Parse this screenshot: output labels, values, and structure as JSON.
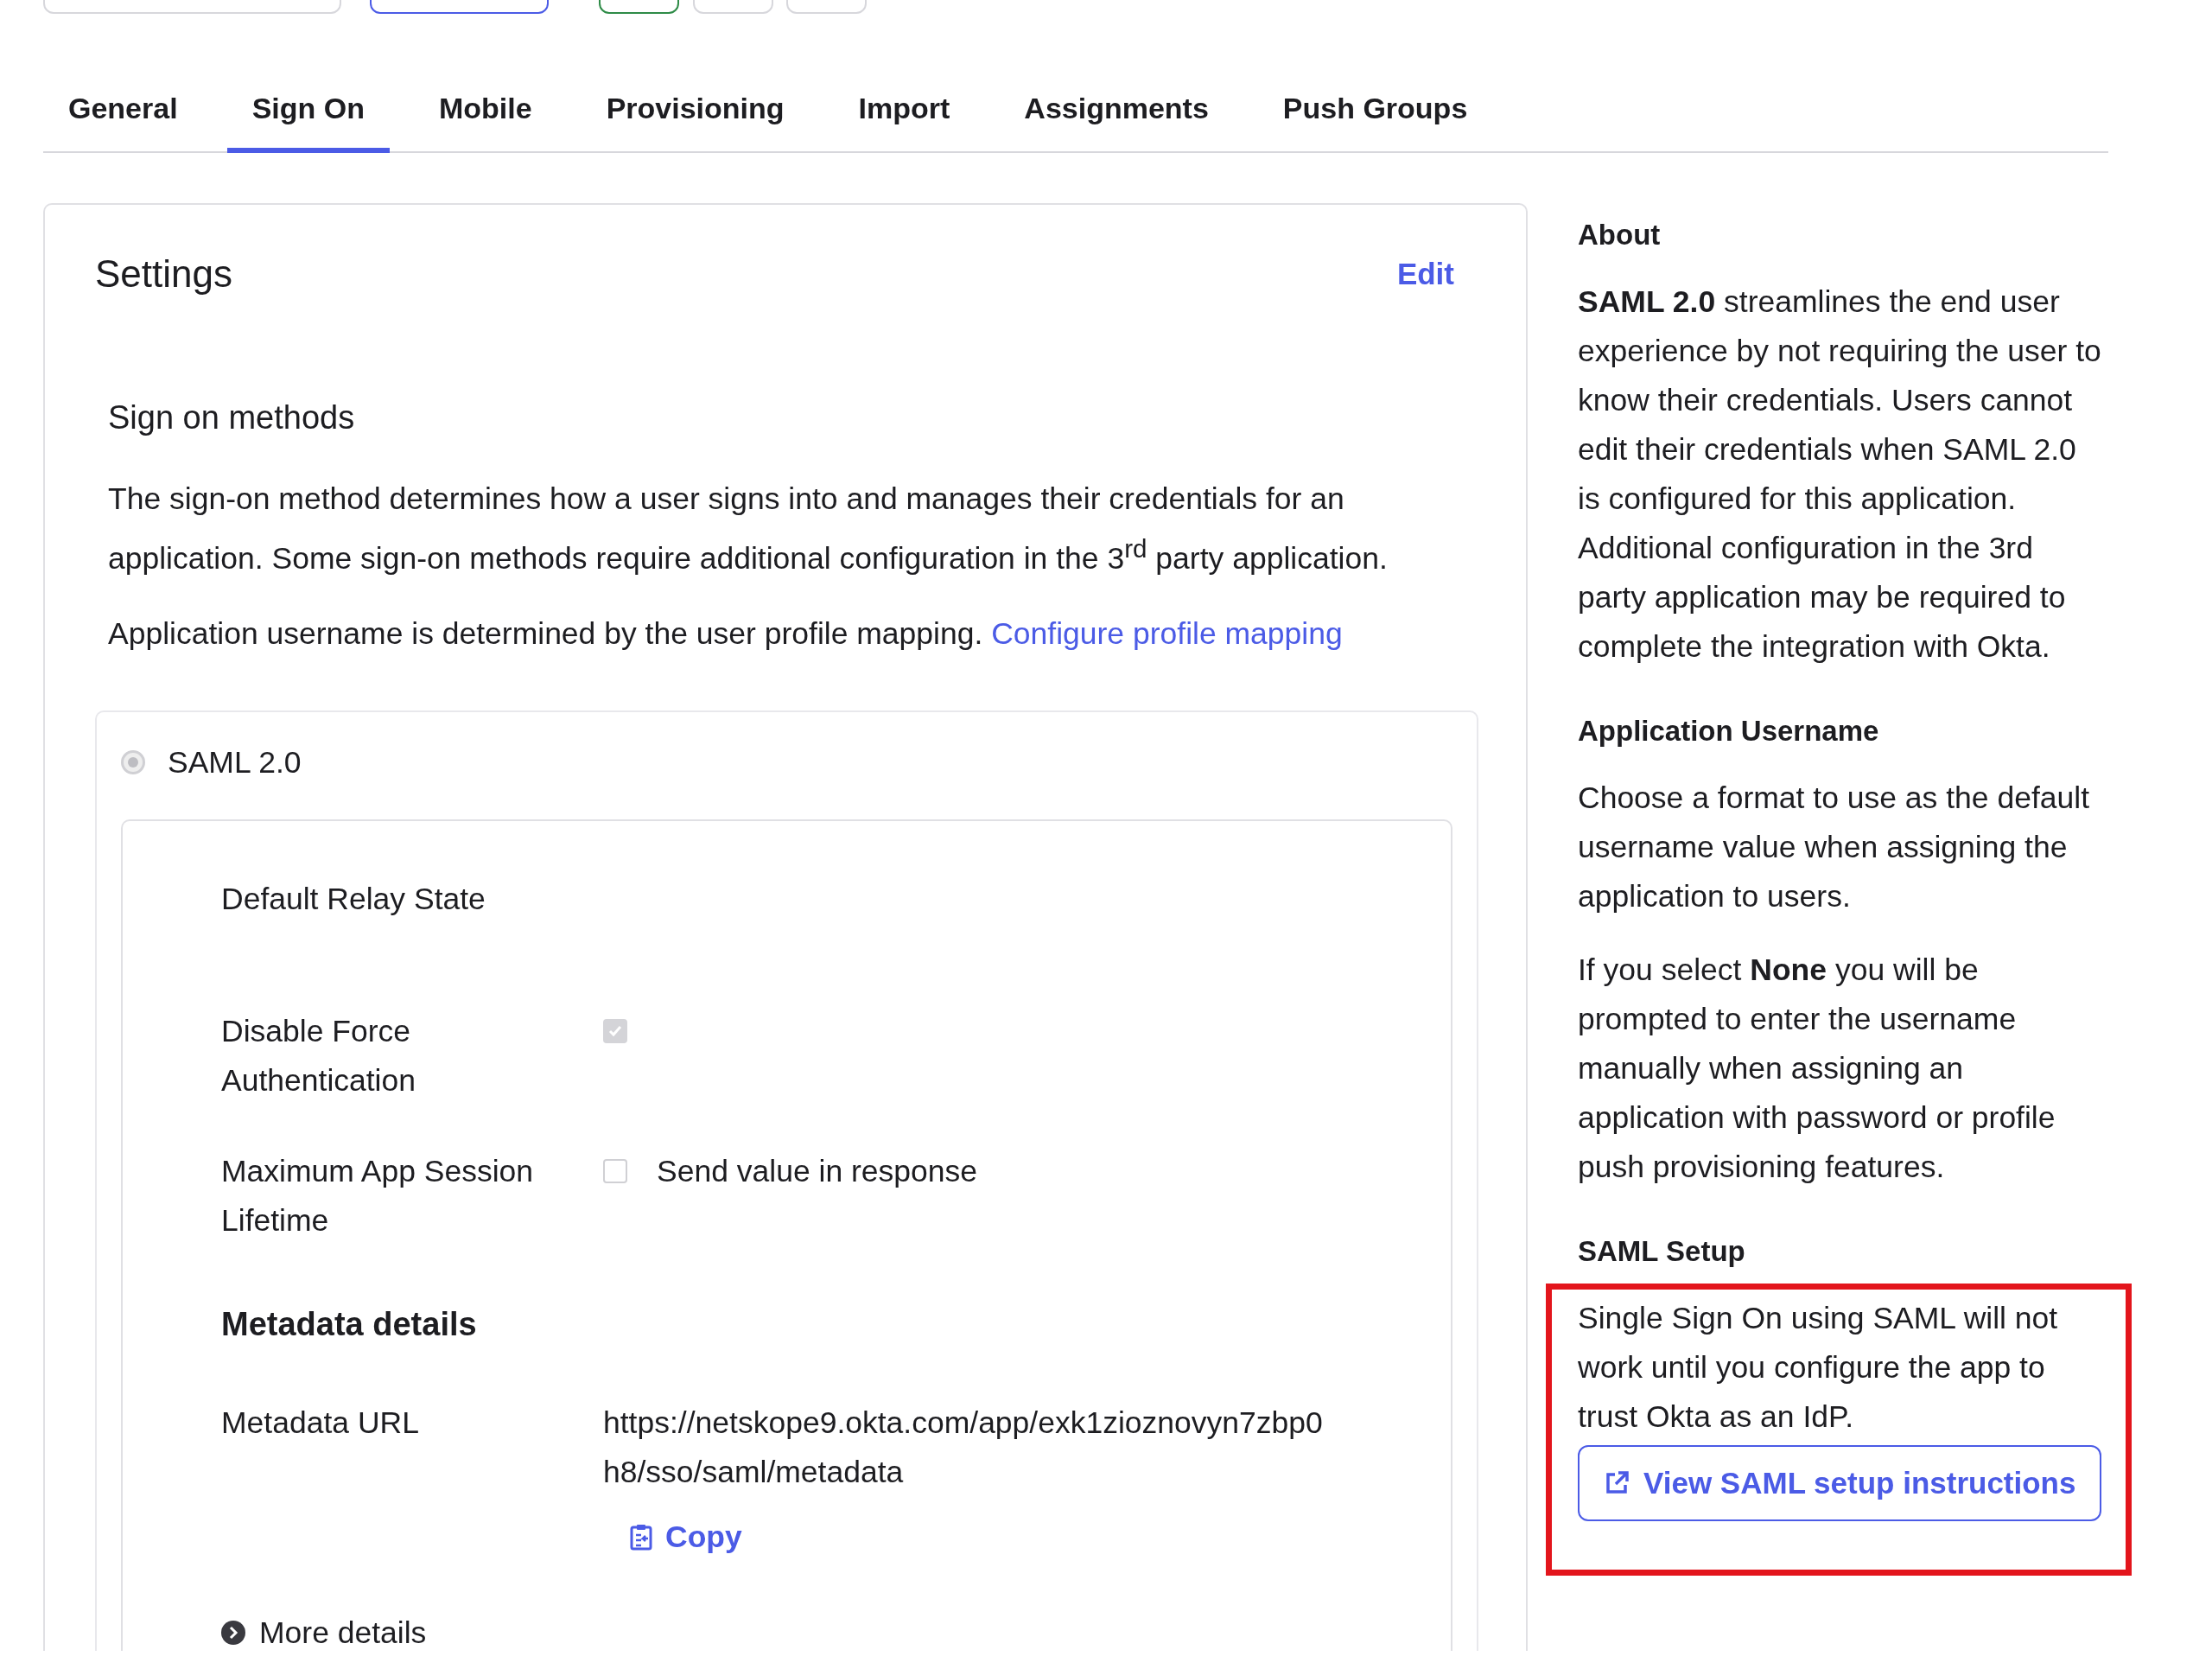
{
  "tabs": [
    {
      "label": "General",
      "selected": false
    },
    {
      "label": "Sign On",
      "selected": true
    },
    {
      "label": "Mobile",
      "selected": false
    },
    {
      "label": "Provisioning",
      "selected": false
    },
    {
      "label": "Import",
      "selected": false
    },
    {
      "label": "Assignments",
      "selected": false
    },
    {
      "label": "Push Groups",
      "selected": false
    }
  ],
  "settings": {
    "title": "Settings",
    "edit": "Edit",
    "section_title": "Sign on methods",
    "description": "The sign-on method determines how a user signs into and manages their credentials for an application. Some sign-on methods require additional configuration in the 3$^{rd}$ party application.",
    "username_note": "Application username is determined by the user profile mapping.",
    "username_link": "Configure profile mapping",
    "method": {
      "label": "SAML 2.0",
      "selected": true
    },
    "fields": [
      {
        "kind": "text",
        "label": "Default Relay State"
      },
      {
        "kind": "checkbox",
        "label": "Disable Force Authentication",
        "checked": true
      },
      {
        "kind": "checkbox",
        "label": "Maximum App Session Lifetime",
        "checked": false,
        "option": "Send value in response"
      }
    ],
    "metadata": {
      "title": "Metadata details",
      "url_label": "Metadata URL",
      "url": "https://netskope9.okta.com/app/exk1zioznovyn7zbp0h8/sso/saml/metadata",
      "copy": "Copy",
      "more": "More details"
    }
  },
  "sidebar": [
    {
      "title": "About",
      "paragraphs": [
        "**SAML 2.0** streamlines the end user experience by not requiring the user to know their credentials. Users cannot edit their credentials when SAML 2.0 is configured for this application. Additional configuration in the 3rd party application may be required to complete the integration with Okta."
      ]
    },
    {
      "title": "Application Username",
      "paragraphs": [
        "Choose a format to use as the default username value when assigning the application to users.",
        "If you select **None** you will be prompted to enter the username manually when assigning an application with password or profile push provisioning features."
      ]
    },
    {
      "title": "SAML Setup",
      "paragraphs": [
        "Single Sign On using SAML will not work until you configure the app to trust Okta as an IdP."
      ],
      "button": "View SAML setup instructions"
    }
  ]
}
